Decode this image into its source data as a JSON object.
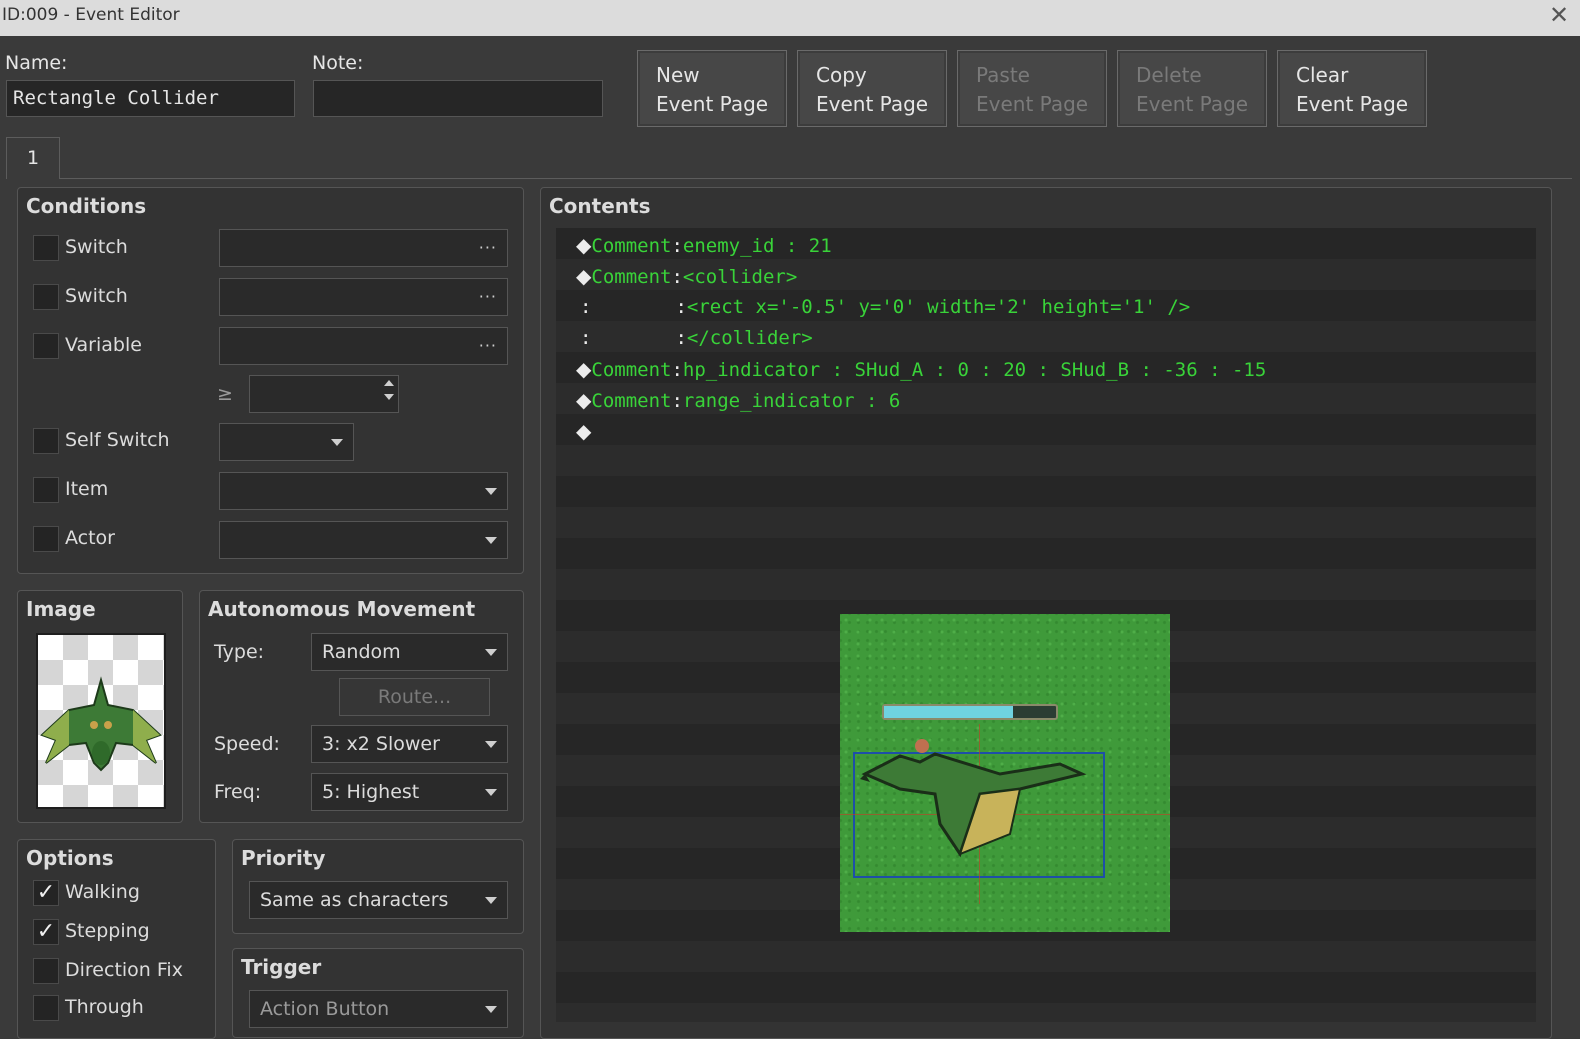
{
  "window": {
    "title": "ID:009 - Event Editor"
  },
  "header": {
    "name_label": "Name:",
    "name_value": "Rectangle Collider",
    "note_label": "Note:",
    "note_value": ""
  },
  "page_buttons": [
    {
      "line1": "New",
      "line2": "Event Page",
      "enabled": true
    },
    {
      "line1": "Copy",
      "line2": "Event Page",
      "enabled": true
    },
    {
      "line1": "Paste",
      "line2": "Event Page",
      "enabled": false
    },
    {
      "line1": "Delete",
      "line2": "Event Page",
      "enabled": false
    },
    {
      "line1": "Clear",
      "line2": "Event Page",
      "enabled": true
    }
  ],
  "tabs": [
    {
      "label": "1"
    }
  ],
  "conditions": {
    "title": "Conditions",
    "switch1": "Switch",
    "switch2": "Switch",
    "variable": "Variable",
    "gte_symbol": "≥",
    "self_switch": "Self Switch",
    "item": "Item",
    "actor": "Actor",
    "dots": "···"
  },
  "image": {
    "title": "Image"
  },
  "movement": {
    "title": "Autonomous Movement",
    "type_label": "Type:",
    "type_value": "Random",
    "route_button": "Route...",
    "speed_label": "Speed:",
    "speed_value": "3: x2 Slower",
    "freq_label": "Freq:",
    "freq_value": "5: Highest"
  },
  "options": {
    "title": "Options",
    "walking": {
      "label": "Walking",
      "checked": true
    },
    "stepping": {
      "label": "Stepping",
      "checked": true
    },
    "direction_fix": {
      "label": "Direction Fix",
      "checked": false
    },
    "through": {
      "label": "Through",
      "checked": false
    },
    "check_mark": "✓"
  },
  "priority": {
    "title": "Priority",
    "value": "Same as characters"
  },
  "trigger": {
    "title": "Trigger",
    "value": "Action Button"
  },
  "contents": {
    "title": "Contents",
    "diamond": "◆",
    "colon": ":",
    "keyword": "Comment",
    "lines": [
      "enemy_id : 21",
      "<collider>",
      "<rect x='-0.5' y='0' width='2' height='1' />",
      "</collider>",
      "hp_indicator : SHud_A : 0 : 20 : SHud_B : -36 : -15",
      "range_indicator : 6"
    ]
  },
  "colors": {
    "background": "#3a3a3a",
    "comment_green": "#39d339",
    "grass": "#3f9a3a",
    "collider_box": "#1e4fa8",
    "hp_bar": "#6fd3e0"
  },
  "preview": {
    "hp_fraction": 0.75
  }
}
